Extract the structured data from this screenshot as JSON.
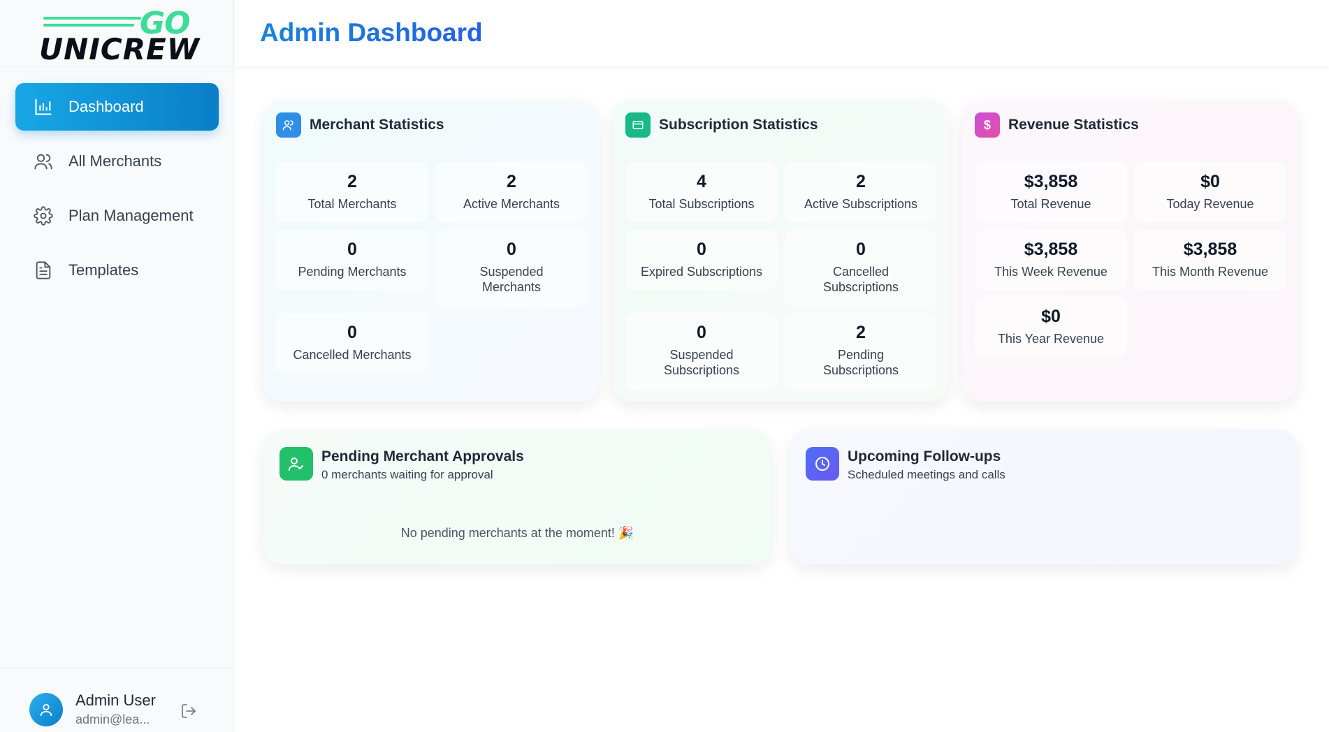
{
  "brand": {
    "logo_top": "GO",
    "logo_word": "UNICREW"
  },
  "sidebar": {
    "items": [
      {
        "label": "Dashboard",
        "icon": "bar-chart-icon",
        "active": true
      },
      {
        "label": "All Merchants",
        "icon": "users-icon",
        "active": false
      },
      {
        "label": "Plan Management",
        "icon": "gear-icon",
        "active": false
      },
      {
        "label": "Templates",
        "icon": "document-icon",
        "active": false
      }
    ],
    "user": {
      "name": "Admin User",
      "email": "admin@lea..."
    }
  },
  "header": {
    "title": "Admin Dashboard"
  },
  "merchant_stats": {
    "title": "Merchant Statistics",
    "items": [
      {
        "value": "2",
        "label": "Total Merchants"
      },
      {
        "value": "2",
        "label": "Active Merchants"
      },
      {
        "value": "0",
        "label": "Pending Merchants"
      },
      {
        "value": "0",
        "label": "Suspended Merchants"
      },
      {
        "value": "0",
        "label": "Cancelled Merchants"
      }
    ]
  },
  "subscription_stats": {
    "title": "Subscription Statistics",
    "items": [
      {
        "value": "4",
        "label": "Total Subscriptions"
      },
      {
        "value": "2",
        "label": "Active Subscriptions"
      },
      {
        "value": "0",
        "label": "Expired Subscriptions"
      },
      {
        "value": "0",
        "label": "Cancelled Subscriptions"
      },
      {
        "value": "0",
        "label": "Suspended Subscriptions"
      },
      {
        "value": "2",
        "label": "Pending Subscriptions"
      }
    ]
  },
  "revenue_stats": {
    "title": "Revenue Statistics",
    "items": [
      {
        "value": "$3,858",
        "label": "Total Revenue"
      },
      {
        "value": "$0",
        "label": "Today Revenue"
      },
      {
        "value": "$3,858",
        "label": "This Week Revenue"
      },
      {
        "value": "$3,858",
        "label": "This Month Revenue"
      },
      {
        "value": "$0",
        "label": "This Year Revenue"
      }
    ]
  },
  "pending_approvals": {
    "title": "Pending Merchant Approvals",
    "subtitle": "0 merchants waiting for approval",
    "empty_message": "No pending merchants at the moment! 🎉"
  },
  "followups": {
    "title": "Upcoming Follow-ups",
    "subtitle": "Scheduled meetings and calls"
  },
  "colors": {
    "accent_blue": "#1a84d8",
    "merchant_icon": "#2f8fe6",
    "subscription_icon": "#18b887",
    "revenue_icon": "#d94bc6",
    "pending_icon": "#22c06a",
    "followup_icon": "#5b6cf0"
  }
}
